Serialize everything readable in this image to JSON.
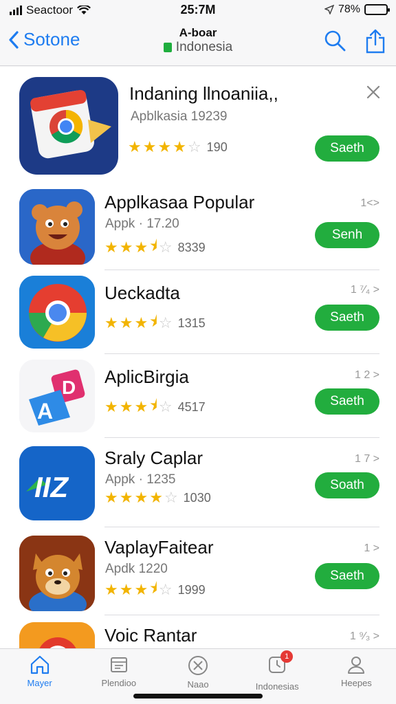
{
  "status": {
    "carrier": "Seactoor",
    "time": "25:7M",
    "battery": "78%",
    "battery_level": 0.78
  },
  "header": {
    "back_label": "Sotone",
    "title": "A-boar",
    "subtitle": "Indonesia"
  },
  "featured": {
    "name": "Indaning llnoaniia,,",
    "subtitle": "Apblkasia 19239",
    "rating_count": "190",
    "button": "Saeth",
    "rating": 4
  },
  "apps": [
    {
      "name": "Applkasaa Popular",
      "subtitle": "Appk · 17.20",
      "rating_count": "8339",
      "rank": "1<>",
      "button": "Senh",
      "rating": 3.5
    },
    {
      "name": "Ueckadta",
      "subtitle": "",
      "rating_count": "1315",
      "rank": "1 ⁷⁄₄ >",
      "button": "Saeth",
      "rating": 3.5
    },
    {
      "name": "AplicBirgia",
      "subtitle": "",
      "rating_count": "4517",
      "rank": "1 2 >",
      "button": "Saeth",
      "rating": 3.5
    },
    {
      "name": "Sraly Caplar",
      "subtitle": "Appk · 1235",
      "rating_count": "1030",
      "rank": "1 7 >",
      "button": "Soath",
      "rating": 4
    },
    {
      "name": "VaplayFaitear",
      "subtitle": "Apdk 1220",
      "rating_count": "1999",
      "rank": "1 >",
      "button": "Saeth",
      "rating": 3.5
    },
    {
      "name": "Voic Rantar",
      "subtitle": "",
      "rating_count": "",
      "rank": "1 ⁹⁄₃ >",
      "button": "",
      "rating": 0
    }
  ],
  "tabs": [
    {
      "label": "Mayer",
      "icon": "home-icon"
    },
    {
      "label": "Plendioo",
      "icon": "calendar-icon"
    },
    {
      "label": "Naao",
      "icon": "close-circle-icon"
    },
    {
      "label": "Indonesias",
      "icon": "clock-icon",
      "badge": "1"
    },
    {
      "label": "Heepes",
      "icon": "person-icon"
    }
  ],
  "colors": {
    "accent": "#1e7cf0",
    "get_button": "#22ad3e",
    "star": "#f2b400"
  }
}
